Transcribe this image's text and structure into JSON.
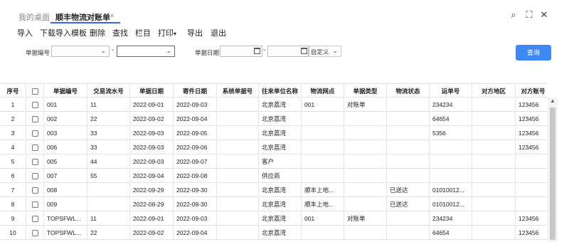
{
  "tabs": [
    {
      "label": "我的桌面"
    },
    {
      "label": "顺丰物流对账单"
    }
  ],
  "tab_close": "×",
  "window_controls": {
    "search": "⌕",
    "expand": "⛶",
    "close": "✕"
  },
  "toolbar": {
    "import": "导入",
    "download_template": "下载导入模板",
    "delete": "删除",
    "find": "查找",
    "columns": "栏目",
    "print": "打印",
    "export": "导出",
    "exit": "退出"
  },
  "filters": {
    "doc_no_label": "单据编号",
    "range_dash": "-",
    "date_label": "单据日期",
    "custom_label": "自定义",
    "query_button": "查询"
  },
  "table": {
    "columns": [
      "序号",
      "",
      "单据编号",
      "交易流水号",
      "单据日期",
      "寄件日期",
      "系统单据号",
      "往来单位名称",
      "物流网点",
      "单据类型",
      "物流状态",
      "运单号",
      "对方地区",
      "对方账号"
    ],
    "rows": [
      [
        "1",
        "",
        "001",
        "11",
        "2022-09-01",
        "2022-09-03",
        "",
        "北京荔湾",
        "001",
        "对账单",
        "",
        "234234",
        "",
        "123456"
      ],
      [
        "2",
        "",
        "002",
        "22",
        "2022-09-02",
        "2022-09-04",
        "",
        "北京荔湾",
        "",
        "",
        "",
        "64654",
        "",
        "123456"
      ],
      [
        "3",
        "",
        "003",
        "33",
        "2022-09-03",
        "2022-09-05",
        "",
        "北京荔湾",
        "",
        "",
        "",
        "5356",
        "",
        "123456"
      ],
      [
        "4",
        "",
        "006",
        "33",
        "2022-09-03",
        "2022-09-06",
        "",
        "北京荔湾",
        "",
        "",
        "",
        "",
        "",
        "123456"
      ],
      [
        "5",
        "",
        "005",
        "44",
        "2022-09-03",
        "2022-09-07",
        "",
        "客户",
        "",
        "",
        "",
        "",
        "",
        ""
      ],
      [
        "6",
        "",
        "007",
        "55",
        "2022-09-04",
        "2022-09-08",
        "",
        "供应商",
        "",
        "",
        "",
        "",
        "",
        ""
      ],
      [
        "7",
        "",
        "008",
        "",
        "2022-09-29",
        "2022-09-30",
        "",
        "北京荔湾",
        "顺丰上地...",
        "",
        "已送达",
        "01010012...",
        "",
        ""
      ],
      [
        "8",
        "",
        "009",
        "",
        "2022-08-29",
        "2022-08-30",
        "",
        "北京荔湾",
        "顺丰上地...",
        "",
        "已送达",
        "01010012...",
        "",
        ""
      ],
      [
        "9",
        "",
        "TOPSFWL...",
        "11",
        "2022-09-01",
        "2022-09-03",
        "",
        "北京荔湾",
        "001",
        "对账单",
        "",
        "234234",
        "",
        "123456"
      ],
      [
        "10",
        "",
        "TOPSFWL...",
        "22",
        "2022-09-02",
        "2022-09-04",
        "",
        "北京荔湾",
        "",
        "",
        "",
        "64654",
        "",
        "123456"
      ]
    ]
  },
  "colors": {
    "accent": "#3a66d6",
    "query_button": "#3d8af7"
  }
}
